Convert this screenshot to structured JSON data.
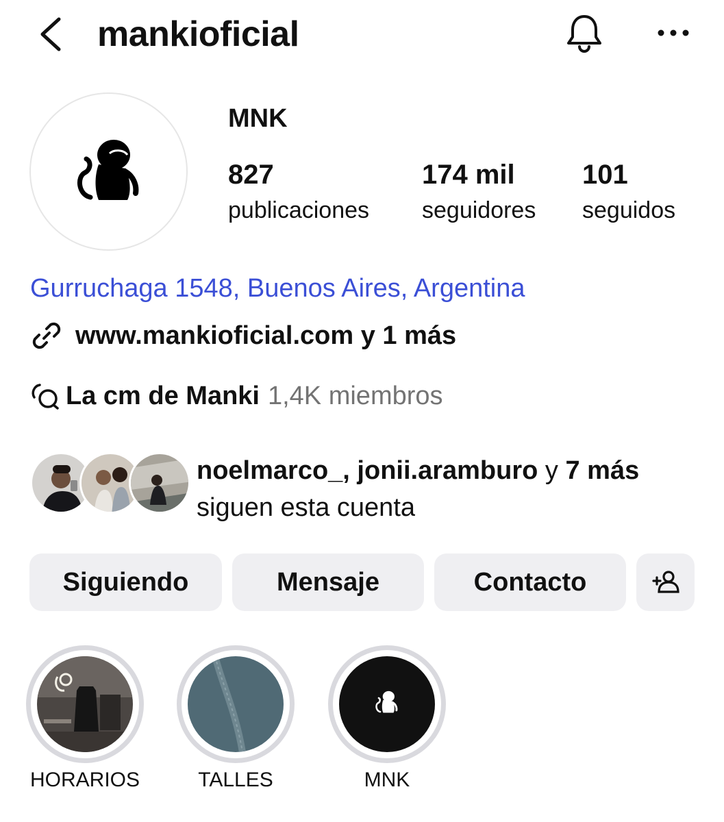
{
  "header": {
    "username": "mankioficial",
    "back_icon": "chevron-left-icon",
    "bell_icon": "bell-icon",
    "more_icon": "more-horizontal-icon"
  },
  "profile": {
    "display_name": "MNK",
    "stats": [
      {
        "value": "827",
        "label": "publicaciones"
      },
      {
        "value": "174 mil",
        "label": "seguidores"
      },
      {
        "value": "101",
        "label": "seguidos"
      }
    ],
    "address": "Gurruchaga 1548, Buenos Aires, Argentina",
    "link": "www.mankioficial.com y 1 más",
    "channel": {
      "name": "La cm de Manki",
      "members": "1,4K miembros"
    },
    "followed_by": {
      "names": "noelmarco_, jonii.aramburo",
      "connector": "y",
      "more": "7 más",
      "suffix": "siguen esta cuenta"
    }
  },
  "actions": {
    "following": "Siguiendo",
    "message": "Mensaje",
    "contact": "Contacto",
    "add_person_icon": "add-person-icon"
  },
  "highlights": [
    {
      "label": "HORARIOS"
    },
    {
      "label": "TALLES"
    },
    {
      "label": "MNK"
    }
  ],
  "colors": {
    "link_blue": "#3b4fd6",
    "button_bg": "#efeff2",
    "muted": "#737373"
  }
}
